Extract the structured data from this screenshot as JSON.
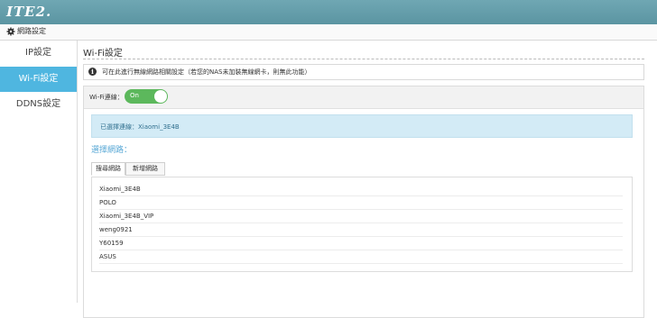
{
  "app": {
    "logo": "ITE2."
  },
  "breadcrumb": {
    "label": "網路設定",
    "icon": "gear-icon"
  },
  "sidebar": {
    "items": [
      {
        "label": "IP設定",
        "active": false
      },
      {
        "label": "Wi-Fi設定",
        "active": true
      },
      {
        "label": "DDNS設定",
        "active": false
      }
    ],
    "active_color": "#4fb6e0"
  },
  "main": {
    "title": "Wi-Fi設定",
    "info": "可在此進行無線網路相關設定（若您的NAS未加裝無線網卡，則無此功能）",
    "wifi_label": "Wi-Fi連線：",
    "toggle": {
      "text": "On",
      "state": true,
      "color": "#5cb85c"
    },
    "connected_text": "已選擇連線：Xiaomi_3E4B",
    "select_heading": "選擇網路：",
    "tabs": [
      {
        "label": "搜尋網路",
        "active": true
      },
      {
        "label": "新增網路",
        "active": false
      }
    ],
    "networks": [
      "Xiaomi_3E4B",
      "POLO",
      "Xiaomi_3E4B_VIP",
      "weng0921",
      "Y60159",
      "ASUS"
    ]
  }
}
